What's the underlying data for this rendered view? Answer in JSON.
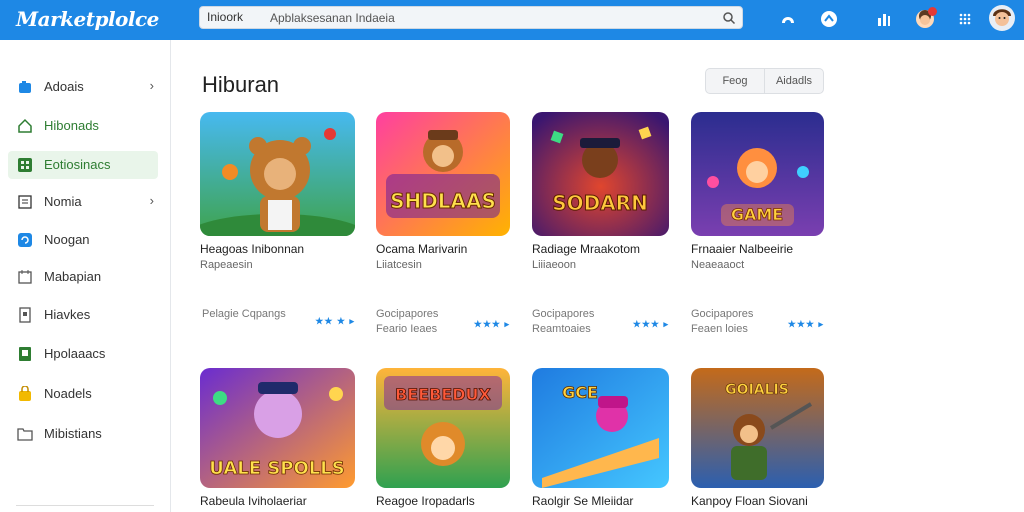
{
  "header": {
    "brand": "Marketplolce",
    "search_scope": "Inioork",
    "search_placeholder": "Apblaksesanan Indaeia",
    "icons": [
      "search-icon",
      "app-icon",
      "chat-icon",
      "stats-icon",
      "notification-icon",
      "apps-grid-icon",
      "user-avatar"
    ]
  },
  "sidebar": {
    "items": [
      {
        "label": "Adoais",
        "icon": "tag-icon",
        "chevron": "›"
      },
      {
        "label": "Hibonads",
        "icon": "home-icon",
        "chevron": ""
      },
      {
        "label": "Eotiosinacs",
        "icon": "grid-icon",
        "chevron": ""
      },
      {
        "label": "Nomia",
        "icon": "list-icon",
        "chevron": "›"
      },
      {
        "label": "Noogan",
        "icon": "refresh-icon",
        "chevron": ""
      },
      {
        "label": "Mabapian",
        "icon": "calendar-icon",
        "chevron": ""
      },
      {
        "label": "Hiavkes",
        "icon": "document-icon",
        "chevron": ""
      },
      {
        "label": "Hpolaaacs",
        "icon": "book-icon",
        "chevron": ""
      },
      {
        "label": "Noadels",
        "icon": "bag-icon",
        "chevron": ""
      },
      {
        "label": "Mibistians",
        "icon": "folder-icon",
        "chevron": ""
      }
    ],
    "active_index": 2
  },
  "main": {
    "title": "Hiburan",
    "toggle": [
      "Feog",
      "Aidadls"
    ],
    "cards": [
      {
        "title": "Heagoas Inibonnan",
        "subtitle": "Rapeaesin",
        "meta1": "Pelagie Cqpangs",
        "meta2": "",
        "rating": "★★ ★ ▸",
        "art_text": "",
        "colors": [
          "#47b9f0",
          "#3fa34d"
        ]
      },
      {
        "title": "Ocama Marivarin",
        "subtitle": "Liiatcesin",
        "meta1": "Gocipapores",
        "meta2": "Feario Ieaes",
        "rating": "★★★ ▸",
        "art_text": "SHDLAAS",
        "colors": [
          "#ff3fa0",
          "#ffb300"
        ]
      },
      {
        "title": "Radiage Mraakotom",
        "subtitle": "Liiiaeoon",
        "meta1": "Gocipapores",
        "meta2": "Reamtoaies",
        "rating": "★★★ ▸",
        "art_text": "SODARN",
        "colors": [
          "#3a1670",
          "#e0462e"
        ]
      },
      {
        "title": "Frnaaier Nalbeeirie",
        "subtitle": "Neaeaaoct",
        "meta1": "Gocipapores",
        "meta2": "Feaen loies",
        "rating": "★★★ ▸",
        "art_text": "GAME",
        "colors": [
          "#2b2d8f",
          "#ff8f3f"
        ]
      },
      {
        "title": "Rabeula Iviholaeriar",
        "subtitle": "",
        "meta1": "",
        "meta2": "",
        "rating": "",
        "art_text": "UALE SPOLLS",
        "colors": [
          "#6a2cd0",
          "#ff9b2f"
        ]
      },
      {
        "title": "Reagoe Iropadarls",
        "subtitle": "",
        "meta1": "",
        "meta2": "",
        "rating": "",
        "art_text": "BEEBEDUX",
        "colors": [
          "#ffb43a",
          "#2fa150"
        ]
      },
      {
        "title": "Raolgir Se Mleiidar",
        "subtitle": "",
        "meta1": "",
        "meta2": "",
        "rating": "",
        "art_text": "GCE",
        "colors": [
          "#1f7be0",
          "#e032a8"
        ]
      },
      {
        "title": "Kanpoy Floan Siovani",
        "subtitle": "",
        "meta1": "",
        "meta2": "",
        "rating": "",
        "art_text": "GOIALIS",
        "colors": [
          "#c46a1a",
          "#2b5fb0"
        ]
      }
    ]
  }
}
